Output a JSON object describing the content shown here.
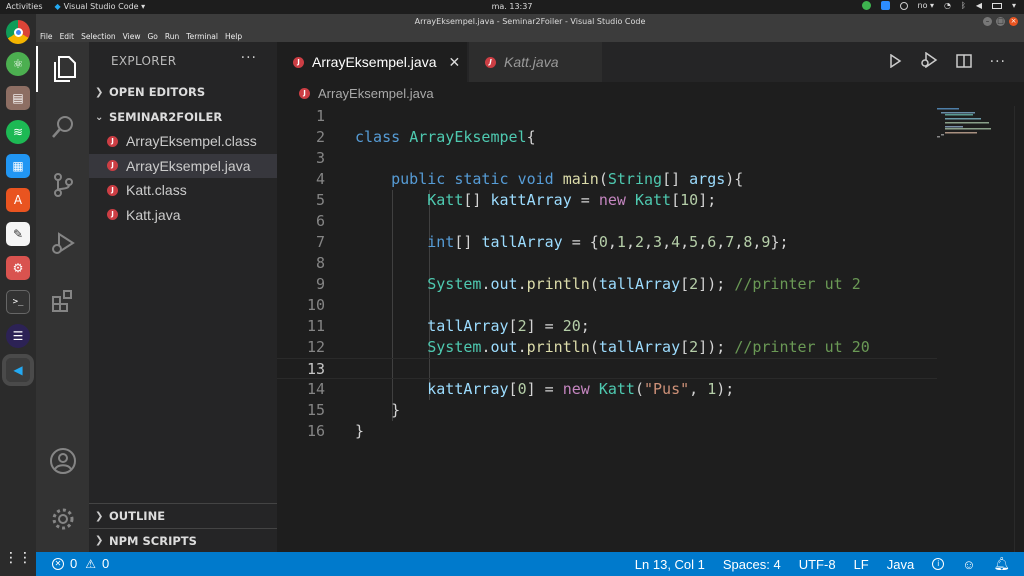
{
  "topbar": {
    "activities": "Activities",
    "app_menu": "Visual Studio Code ▾",
    "clock": "ma. 13:37",
    "lang": "no ▾"
  },
  "window": {
    "title": "ArrayEksempel.java - Seminar2Foiler - Visual Studio Code"
  },
  "menu": [
    "File",
    "Edit",
    "Selection",
    "View",
    "Go",
    "Run",
    "Terminal",
    "Help"
  ],
  "sidebar": {
    "title": "EXPLORER",
    "more": "···",
    "open_editors": "OPEN EDITORS",
    "folder": "SEMINAR2FOILER",
    "files": [
      "ArrayEksempel.class",
      "ArrayEksempel.java",
      "Katt.class",
      "Katt.java"
    ],
    "outline": "OUTLINE",
    "npm_scripts": "NPM SCRIPTS"
  },
  "tabs": [
    {
      "label": "ArrayEksempel.java",
      "icon": "J"
    },
    {
      "label": "Katt.java",
      "icon": "J"
    }
  ],
  "breadcrumb": "ArrayEksempel.java",
  "line_numbers": [
    "1",
    "2",
    "3",
    "4",
    "5",
    "6",
    "7",
    "8",
    "9",
    "10",
    "11",
    "12",
    "13",
    "14",
    "15",
    "16"
  ],
  "code": [
    "",
    "class ArrayEksempel{",
    "",
    "    public static void main(String[] args){",
    "        Katt[] kattArray = new Katt[10];",
    "",
    "        int[] tallArray = {0,1,2,3,4,5,6,7,8,9};",
    "",
    "        System.out.println(tallArray[2]); //printer ut 2",
    "",
    "        tallArray[2] = 20;",
    "        System.out.println(tallArray[2]); //printer ut 20",
    "",
    "        kattArray[0] = new Katt(\"Pus\", 1);",
    "    }",
    "}"
  ],
  "status": {
    "errors": "0",
    "warnings": "0",
    "position": "Ln 13, Col 1",
    "spaces": "Spaces: 4",
    "encoding": "UTF-8",
    "eol": "LF",
    "language": "Java"
  },
  "colors": {
    "accent": "#007acc",
    "java_icon": "#cc3e44",
    "editor_bg": "#1e1e1e"
  }
}
